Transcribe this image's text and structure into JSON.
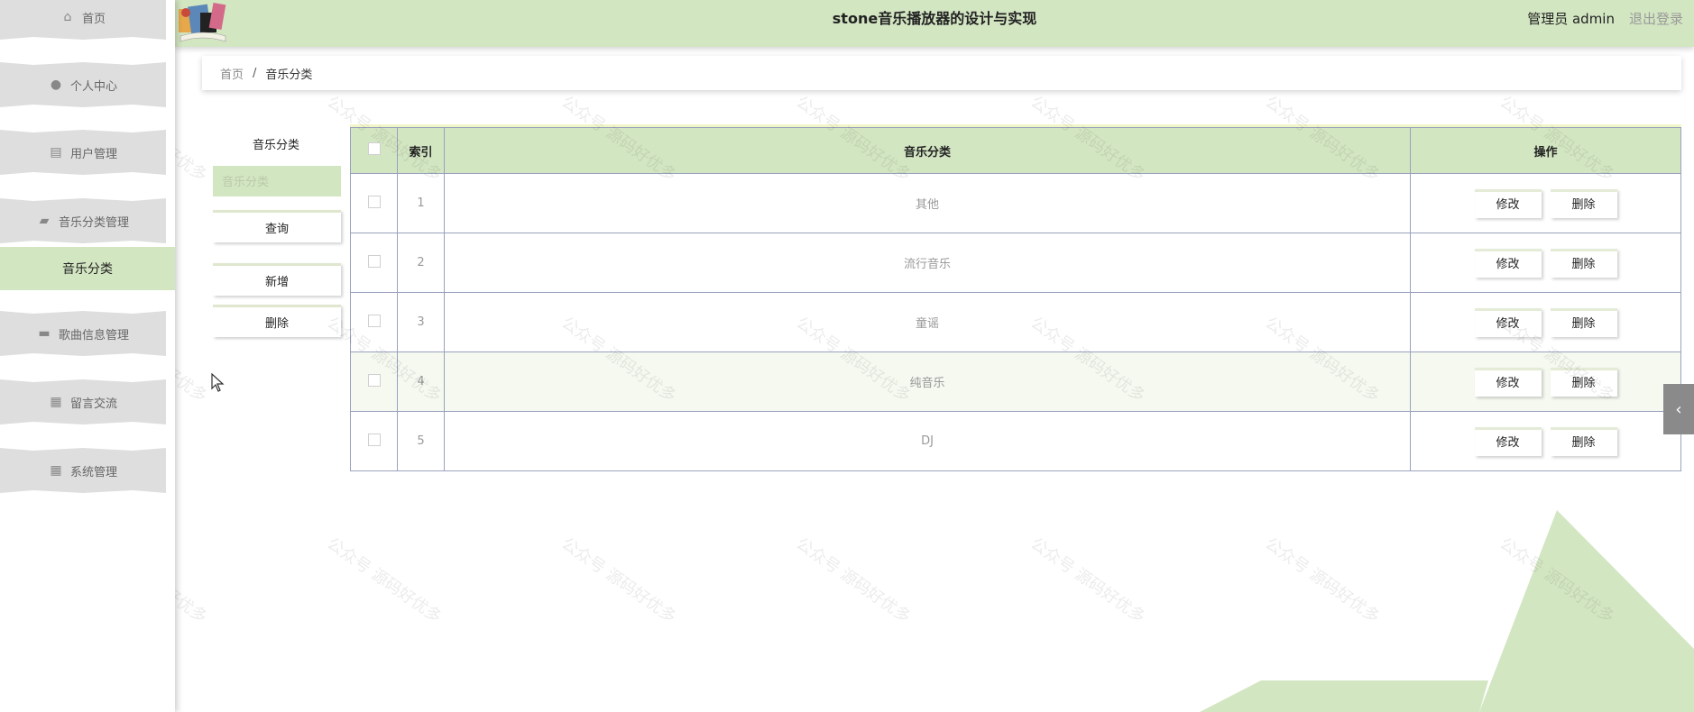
{
  "sidebar": {
    "items": [
      {
        "label": "首页",
        "icon": "home-icon"
      },
      {
        "label": "个人中心",
        "icon": "user-icon"
      },
      {
        "label": "用户管理",
        "icon": "clipboard-icon"
      },
      {
        "label": "音乐分类管理",
        "icon": "category-icon"
      },
      {
        "label": "歌曲信息管理",
        "icon": "message-icon"
      },
      {
        "label": "留言交流",
        "icon": "grid-icon"
      },
      {
        "label": "系统管理",
        "icon": "grid-icon"
      }
    ],
    "active_sub": "音乐分类"
  },
  "header": {
    "title": "stone音乐播放器的设计与实现",
    "user": "管理员 admin",
    "logout": "退出登录"
  },
  "breadcrumb": {
    "home": "首页",
    "separator": "/",
    "current": "音乐分类"
  },
  "filter": {
    "label": "音乐分类",
    "placeholder": "音乐分类",
    "query_btn": "查询",
    "add_btn": "新增",
    "delete_btn": "删除"
  },
  "table": {
    "columns": [
      "索引",
      "音乐分类",
      "操作"
    ],
    "edit_label": "修改",
    "delete_label": "删除",
    "rows": [
      {
        "index": "1",
        "category": "其他"
      },
      {
        "index": "2",
        "category": "流行音乐"
      },
      {
        "index": "3",
        "category": "童谣"
      },
      {
        "index": "4",
        "category": "纯音乐"
      },
      {
        "index": "5",
        "category": "DJ"
      }
    ]
  },
  "watermark": "公众号 源码好优多",
  "colors": {
    "accent": "#d3e6c2",
    "border": "#9aa1bd"
  }
}
